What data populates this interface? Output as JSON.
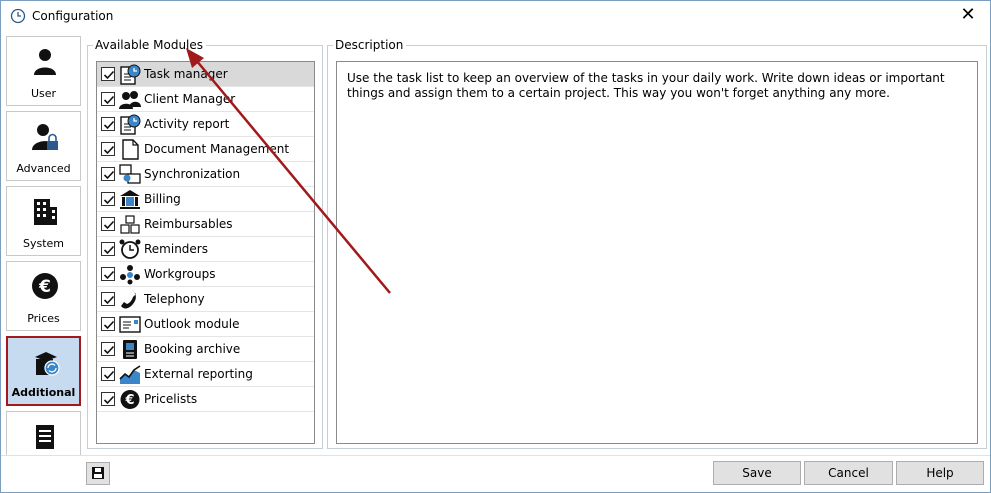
{
  "window": {
    "title": "Configuration",
    "close_glyph": "✕"
  },
  "nav": {
    "items": [
      {
        "label": "User",
        "icon": "user-icon"
      },
      {
        "label": "Advanced",
        "icon": "user-lock-icon"
      },
      {
        "label": "System",
        "icon": "building-icon"
      },
      {
        "label": "Prices",
        "icon": "euro-icon"
      },
      {
        "label": "Additional",
        "icon": "additional-box-icon",
        "active": true
      },
      {
        "label": "",
        "icon": "printer-document-icon"
      }
    ]
  },
  "modules": {
    "title": "Available Modules",
    "items": [
      {
        "label": "Task manager",
        "checked": true,
        "selected": true,
        "icon": "task-clock-icon"
      },
      {
        "label": "Client Manager",
        "checked": true,
        "icon": "people-icon"
      },
      {
        "label": "Activity report",
        "checked": true,
        "icon": "report-clock-icon"
      },
      {
        "label": "Document Management",
        "checked": true,
        "icon": "document-icon"
      },
      {
        "label": "Synchronization",
        "checked": true,
        "icon": "sync-icon"
      },
      {
        "label": "Billing",
        "checked": true,
        "icon": "bank-icon"
      },
      {
        "label": "Reimbursables",
        "checked": true,
        "icon": "boxes-icon"
      },
      {
        "label": "Reminders",
        "checked": true,
        "icon": "alarm-clock-icon"
      },
      {
        "label": "Workgroups",
        "checked": true,
        "icon": "workgroup-icon"
      },
      {
        "label": "Telephony",
        "checked": true,
        "icon": "phone-icon"
      },
      {
        "label": "Outlook module",
        "checked": true,
        "icon": "outlook-icon"
      },
      {
        "label": "Booking archive",
        "checked": true,
        "icon": "archive-icon"
      },
      {
        "label": "External reporting",
        "checked": true,
        "icon": "chart-icon"
      },
      {
        "label": "Pricelists",
        "checked": true,
        "icon": "euro-icon"
      }
    ]
  },
  "description": {
    "title": "Description",
    "text": "Use the task list to keep an overview of the tasks in your daily work. Write down ideas or important things and assign them to a certain project. This way you won't forget anything any more."
  },
  "buttons": {
    "save": "Save",
    "cancel": "Cancel",
    "help": "Help"
  },
  "colors": {
    "accent_border": "#a0191b",
    "active_bg": "#c7dbf0",
    "arrow": "#a0191b"
  }
}
